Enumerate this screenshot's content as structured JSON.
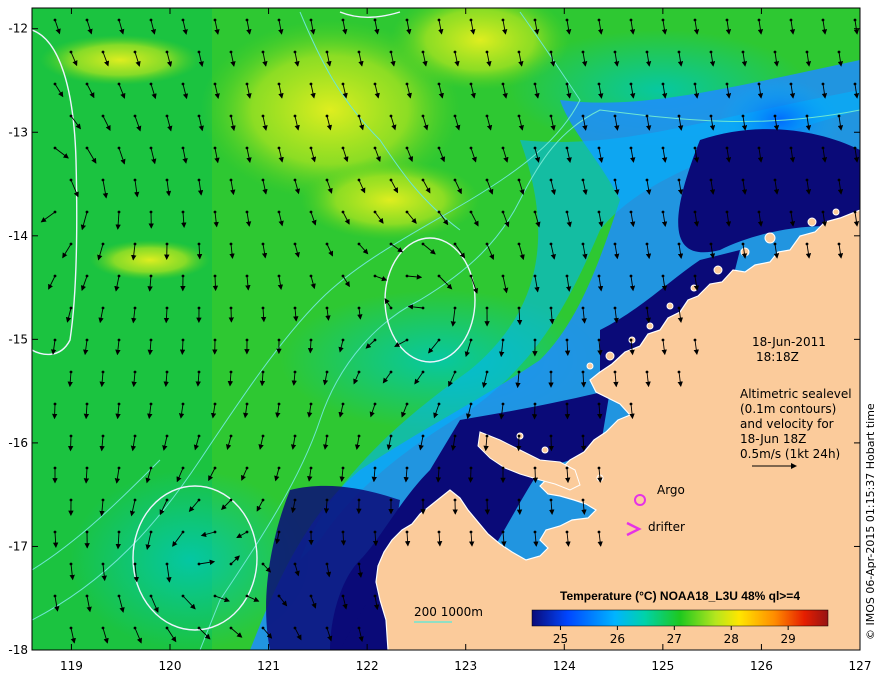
{
  "map": {
    "x_ticks": [
      "119",
      "120",
      "121",
      "122",
      "123",
      "124",
      "125",
      "126",
      "127"
    ],
    "y_ticks": [
      "-12",
      "-13",
      "-14",
      "-15",
      "-16",
      "-17",
      "-18"
    ],
    "x_range": [
      118.6,
      127.0
    ],
    "y_range": [
      -18.0,
      -11.8
    ]
  },
  "annotations": {
    "date": "18-Jun-2011",
    "time": "18:18Z",
    "description": [
      "Altimetric sealevel",
      "(0.1m contours)",
      "and velocity for",
      "18-Jun 18Z",
      "0.5m/s (1kt 24h)"
    ],
    "argo_label": "Argo",
    "drifter_label": "drifter",
    "depth_label": "200  1000m"
  },
  "legend": {
    "title": "Temperature (°C) NOAA18_L3U 48% ql>=4",
    "ticks": [
      "25",
      "26",
      "27",
      "28",
      "29"
    ],
    "colors": [
      "#0a0a78",
      "#0046ff",
      "#00b4ff",
      "#00d2aa",
      "#1ec81e",
      "#b4e61e",
      "#ffe600",
      "#ff8c00",
      "#e61e00",
      "#961414"
    ]
  },
  "credit": "© IMOS 06-Apr-2015 01:15:37 Hobart time",
  "colors": {
    "land": "#fbcb9b",
    "deep": "#0a0a78",
    "contour": "#e6f0ff",
    "isobath": "#6ee6d2",
    "marker": "#e632e6"
  }
}
